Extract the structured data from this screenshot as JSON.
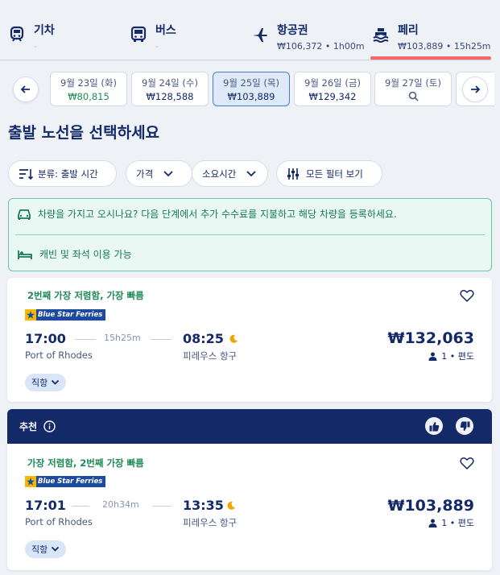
{
  "modes": [
    {
      "name": "기차",
      "sub": "-",
      "icon": "train-icon"
    },
    {
      "name": "버스",
      "sub": "-",
      "icon": "bus-icon"
    },
    {
      "name": "항공권",
      "sub": "₩106,372 • 1h00m",
      "icon": "plane-icon"
    },
    {
      "name": "페리",
      "sub": "₩103,889 • 15h25m",
      "icon": "ferry-icon"
    }
  ],
  "dates": [
    {
      "day": "9월 23일 (화)",
      "price": "₩80,815"
    },
    {
      "day": "9월 24일 (수)",
      "price": "₩128,588"
    },
    {
      "day": "9월 25일 (목)",
      "price": "₩103,889"
    },
    {
      "day": "9월 26일 (금)",
      "price": "₩129,342"
    },
    {
      "day": "9월 27일 (토)",
      "price": ""
    }
  ],
  "page_title": "출발 노선을 선택하세요",
  "filters": {
    "sort": "분류: 출발 시간",
    "price": "가격",
    "duration": "소요시간",
    "all": "모든 필터 보기"
  },
  "info": {
    "car": "차량을 가지고 오시나요? 다음 단계에서 추가 수수료를 지불하고 해당 차량을 등록하세요.",
    "cabin": "캐빈 및 좌석 이용 가능"
  },
  "recommended_label": "추천",
  "results": [
    {
      "tag": "2번째 가장 저렴함, 가장 빠름",
      "operator": "Blue Star Ferries",
      "depart_time": "17:00",
      "depart_place": "Port of Rhodes",
      "duration": "15h25m",
      "arrive_time": "08:25",
      "arrive_place": "피레우스 항구",
      "price": "₩132,063",
      "pax": "1 • 편도",
      "stops": "직항"
    },
    {
      "tag": "가장 저렴함, 2번째 가장 빠름",
      "operator": "Blue Star Ferries",
      "depart_time": "17:01",
      "depart_place": "Port of Rhodes",
      "duration": "20h34m",
      "arrive_time": "13:35",
      "arrive_place": "피레우스 항구",
      "price": "₩103,889",
      "pax": "1 • 편도",
      "stops": "직항"
    }
  ],
  "colors": {
    "navy": "#132968",
    "green": "#1f8a55",
    "accent_red": "#f46a6a",
    "active_date": "#dfeaf8"
  }
}
